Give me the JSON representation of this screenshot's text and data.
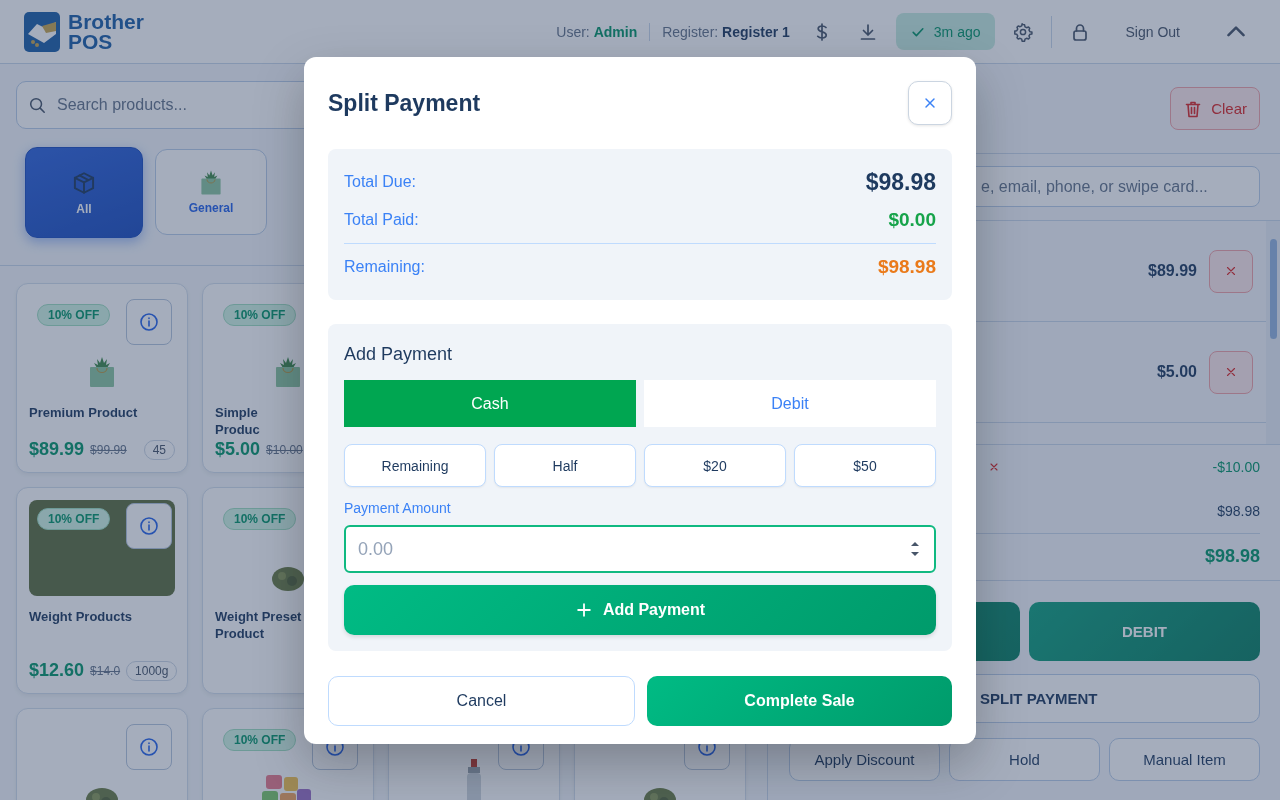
{
  "header": {
    "brand_line1": "Brother",
    "brand_line2": "POS",
    "user_label": "User:",
    "user_value": "Admin",
    "register_label": "Register:",
    "register_value": "Register 1",
    "sync_status": "3m ago",
    "sign_out": "Sign Out"
  },
  "products": {
    "search_placeholder": "Search products...",
    "categories": [
      {
        "label": "All",
        "selected": true,
        "kind": "box"
      },
      {
        "label": "General",
        "selected": false,
        "kind": "bag"
      }
    ],
    "cards": [
      {
        "name": "Premium Product",
        "badge": "10% OFF",
        "price": "$89.99",
        "old_price": "$99.99",
        "stock": "45",
        "kind": "bag"
      },
      {
        "name": "Simple Produc",
        "badge": "10% OFF",
        "price": "$5.00",
        "old_price": "$10.00",
        "kind": "bag"
      },
      {
        "name": "Weight Products",
        "badge": "10% OFF",
        "price": "$12.60",
        "old_price": "$14.0",
        "stock": "1000g",
        "kind": "photo"
      },
      {
        "name": "Weight Preset Product",
        "badge": "10% OFF",
        "kind": "bud"
      },
      {
        "kind": "bud"
      },
      {
        "badge": "10% OFF",
        "kind": "gummies"
      },
      {
        "kind": "lighter"
      },
      {
        "kind": "bud"
      }
    ]
  },
  "cart": {
    "clear": "Clear",
    "customer_search_placeholder": "e, email, phone, or swipe card...",
    "items": [
      {
        "price": "$89.99"
      },
      {
        "price": "$5.00"
      }
    ],
    "discount_amount": "-$10.00",
    "subtotal": "$98.98",
    "total": "$98.98",
    "debit": "DEBIT",
    "split_payment": "SPLIT PAYMENT",
    "actions": [
      "Apply Discount",
      "Hold",
      "Manual Item"
    ]
  },
  "split_payment": {
    "title": "Split Payment",
    "summary": [
      {
        "label": "Total Due:",
        "value": "$98.98",
        "kind": "due"
      },
      {
        "label": "Total Paid:",
        "value": "$0.00",
        "kind": "paid"
      },
      {
        "label": "Remaining:",
        "value": "$98.98",
        "kind": "remaining"
      }
    ],
    "add_payment": {
      "title": "Add Payment",
      "methods": [
        {
          "label": "Cash",
          "selected": true
        },
        {
          "label": "Debit",
          "selected": false
        }
      ],
      "quick_amounts": [
        "Remaining",
        "Half",
        "$20",
        "$50"
      ],
      "amount_label": "Payment Amount",
      "amount_placeholder": "0.00",
      "add_button": "Add Payment"
    },
    "cancel": "Cancel",
    "complete": "Complete Sale"
  }
}
